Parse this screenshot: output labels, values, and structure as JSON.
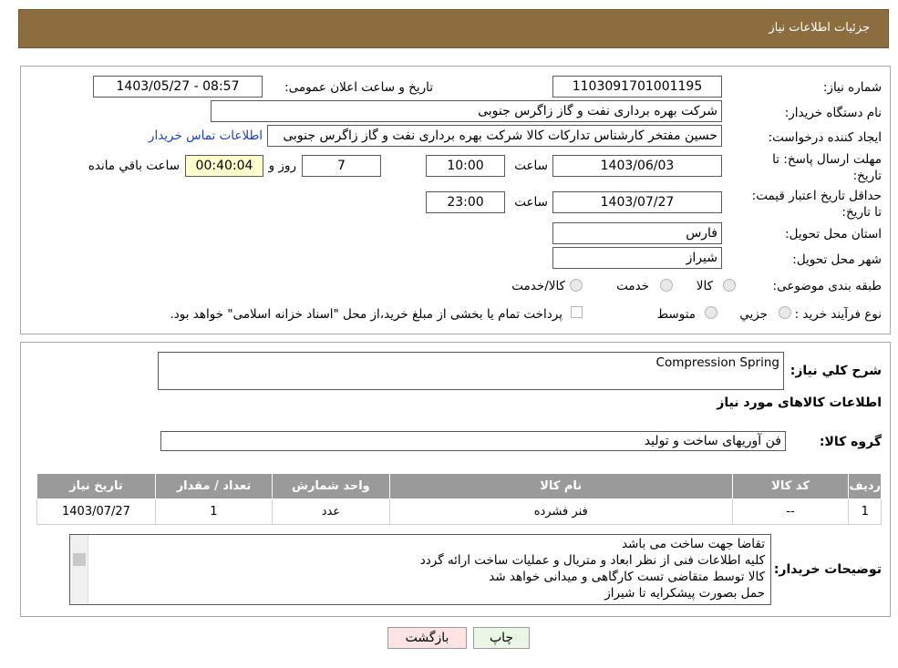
{
  "header": {
    "title": "جزئیات اطلاعات نیاز"
  },
  "form": {
    "need_number_label": "شماره نیاز:",
    "need_number": "1103091701001195",
    "announce_label": "تاریخ و ساعت اعلان عمومی:",
    "announce_value": "1403/05/27 - 08:57",
    "buyer_label": "نام دستگاه خریدار:",
    "buyer_value": "شرکت بهره برداری نفت و گاز زاگرس جنوبی",
    "creator_label": "ایجاد کننده درخواست:",
    "creator_value": "حسین مفتخر کارشناس تدارکات کالا شرکت بهره برداری نفت و گاز زاگرس جنوبی",
    "contact_link": "اطلاعات تماس خریدار",
    "deadline_label": "مهلت ارسال پاسخ: تا تاریخ:",
    "deadline_date": "1403/06/03",
    "time_label": "ساعت",
    "deadline_time": "10:00",
    "days_value": "7",
    "days_label": "روز و",
    "remaining_time": "00:40:04",
    "remaining_label": "ساعت باقي مانده",
    "validity_label": "حداقل تاريخ اعتبار قيمت: تا تاريخ:",
    "validity_date": "1403/07/27",
    "validity_time": "23:00",
    "province_label": "استان محل تحویل:",
    "province_value": "فارس",
    "city_label": "شهر محل تحویل:",
    "city_value": "شیراز",
    "category_label": "طبقه بندی موضوعی:",
    "category_options": [
      "کالا",
      "خدمت",
      "کالا/خدمت"
    ],
    "process_label": "نوع فرآیند خرید :",
    "process_options": [
      "جزیي",
      "متوسط"
    ],
    "payment_text": "پرداخت تمام یا بخشی از مبلغ خرید،از محل \"اسناد خزانه اسلامی\" خواهد بود."
  },
  "details": {
    "summary_label": "شرح كلي نياز:",
    "summary_value": "Compression Spring",
    "goods_info_title": "اطلاعات کالاهای مورد نیاز",
    "group_label": "گروه کالا:",
    "group_value": "فن آوریهای ساخت و تولید",
    "table": {
      "headers": [
        "ردیف",
        "کد کالا",
        "نام کالا",
        "واحد شمارش",
        "تعداد / مقدار",
        "تاریخ نیاز"
      ],
      "rows": [
        [
          "1",
          "--",
          "فنر فشرده",
          "عدد",
          "1",
          "1403/07/27"
        ]
      ]
    },
    "notes_label": "توضیحات خریدار:",
    "notes": [
      "تقاضا جهت ساخت می باشد",
      "کلیه اطلاعات فنی از نظر ابعاد و متریال و عملیات ساخت ارائه گردد",
      "کالا توسط متقاضی تست کارگاهی و میدانی خواهد شد",
      "حمل بصورت پیشکرایه تا شیراز"
    ]
  },
  "buttons": {
    "print": "چاپ",
    "back": "بازگشت"
  },
  "colors": {
    "header_bg": "#8c6d3f",
    "remaining_bg": "#ffffcc",
    "print_bg": "#eaf7e4",
    "back_bg": "#fde3e3"
  }
}
